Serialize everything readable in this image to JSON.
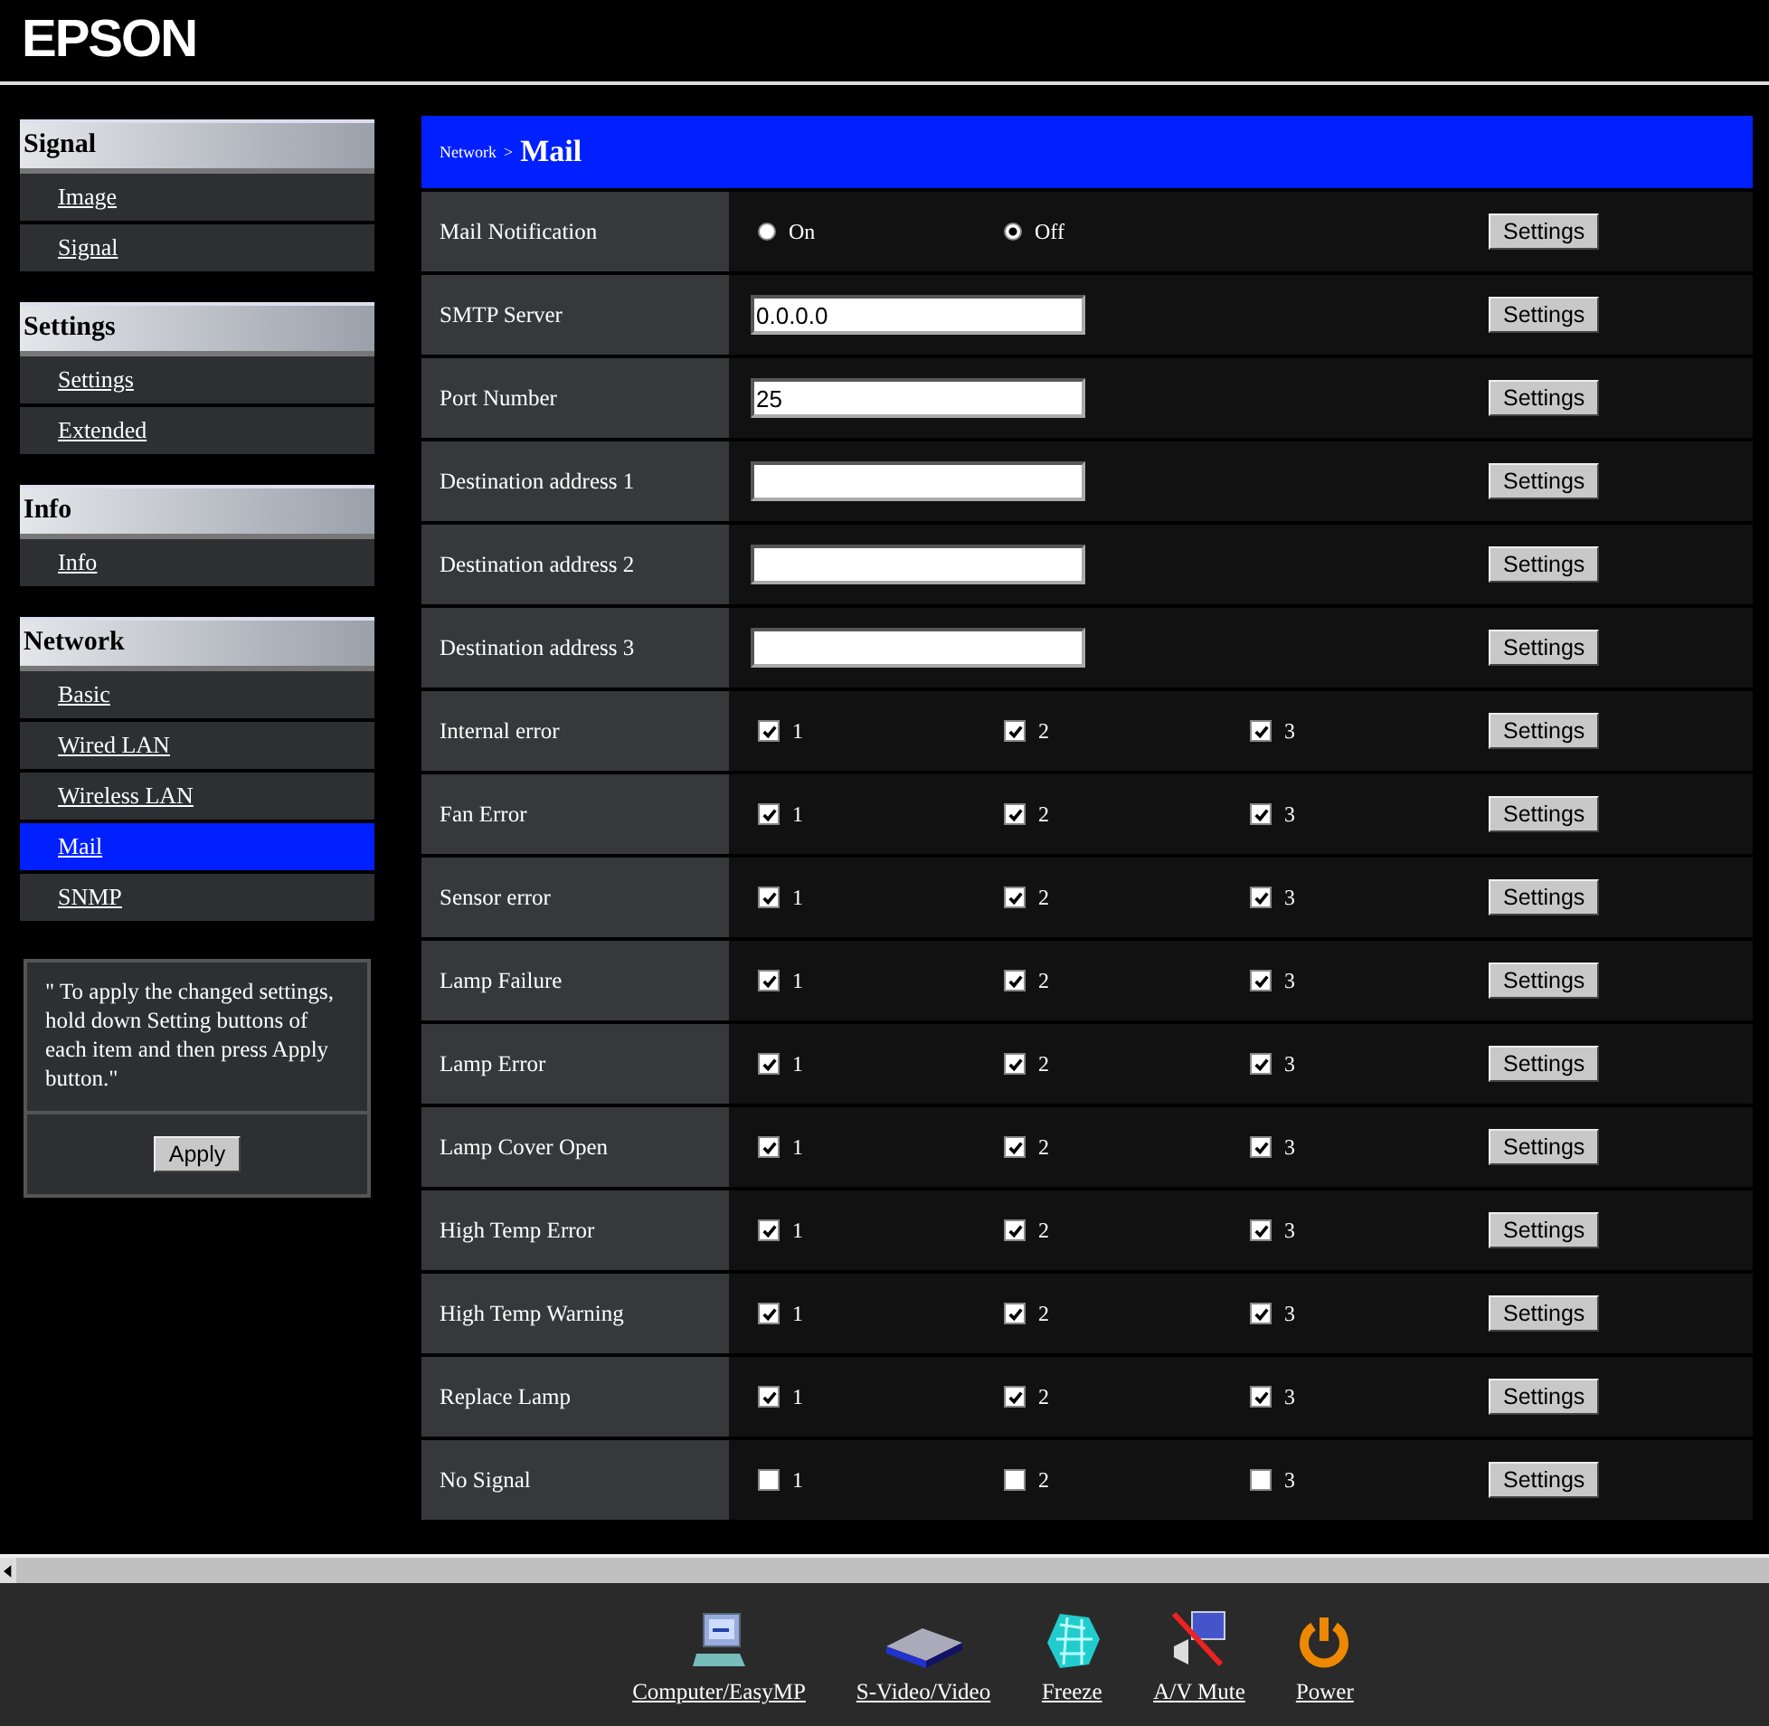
{
  "brand": "EPSON",
  "sidebar": [
    {
      "title": "Signal",
      "items": [
        {
          "label": "Image",
          "selected": false
        },
        {
          "label": "Signal",
          "selected": false
        }
      ]
    },
    {
      "title": "Settings",
      "items": [
        {
          "label": "Settings",
          "selected": false
        },
        {
          "label": "Extended",
          "selected": false
        }
      ]
    },
    {
      "title": "Info",
      "items": [
        {
          "label": "Info",
          "selected": false
        }
      ]
    },
    {
      "title": "Network",
      "items": [
        {
          "label": "Basic",
          "selected": false
        },
        {
          "label": "Wired LAN",
          "selected": false
        },
        {
          "label": "Wireless LAN",
          "selected": false
        },
        {
          "label": "Mail",
          "selected": true
        },
        {
          "label": "SNMP",
          "selected": false
        }
      ]
    }
  ],
  "note": "\" To apply the changed settings, hold down Setting buttons of each item and then press Apply button.\"",
  "apply_button": "Apply",
  "breadcrumb": {
    "parent": "Network",
    "separator": ">",
    "current": "Mail"
  },
  "rows": [
    {
      "kind": "radio",
      "label": "Mail Notification",
      "options": [
        {
          "label": "On",
          "selected": false
        },
        {
          "label": "Off",
          "selected": true
        }
      ],
      "button": "Settings"
    },
    {
      "kind": "text",
      "label": "SMTP Server",
      "value": "0.0.0.0",
      "button": "Settings"
    },
    {
      "kind": "text",
      "label": "Port Number",
      "value": "25",
      "button": "Settings"
    },
    {
      "kind": "text",
      "label": "Destination address 1",
      "button": "Settings"
    },
    {
      "kind": "text",
      "label": "Destination address 2",
      "button": "Settings"
    },
    {
      "kind": "text",
      "label": "Destination address 3",
      "button": "Settings"
    },
    {
      "kind": "checks",
      "label": "Internal error",
      "checks": [
        {
          "label": "1",
          "checked": true
        },
        {
          "label": "2",
          "checked": true
        },
        {
          "label": "3",
          "checked": true
        }
      ],
      "button": "Settings"
    },
    {
      "kind": "checks",
      "label": "Fan Error",
      "checks": [
        {
          "label": "1",
          "checked": true
        },
        {
          "label": "2",
          "checked": true
        },
        {
          "label": "3",
          "checked": true
        }
      ],
      "button": "Settings"
    },
    {
      "kind": "checks",
      "label": "Sensor error",
      "checks": [
        {
          "label": "1",
          "checked": true
        },
        {
          "label": "2",
          "checked": true
        },
        {
          "label": "3",
          "checked": true
        }
      ],
      "button": "Settings"
    },
    {
      "kind": "checks",
      "label": "Lamp Failure",
      "checks": [
        {
          "label": "1",
          "checked": true
        },
        {
          "label": "2",
          "checked": true
        },
        {
          "label": "3",
          "checked": true
        }
      ],
      "button": "Settings"
    },
    {
      "kind": "checks",
      "label": "Lamp Error",
      "checks": [
        {
          "label": "1",
          "checked": true
        },
        {
          "label": "2",
          "checked": true
        },
        {
          "label": "3",
          "checked": true
        }
      ],
      "button": "Settings"
    },
    {
      "kind": "checks",
      "label": "Lamp Cover Open",
      "checks": [
        {
          "label": "1",
          "checked": true
        },
        {
          "label": "2",
          "checked": true
        },
        {
          "label": "3",
          "checked": true
        }
      ],
      "button": "Settings"
    },
    {
      "kind": "checks",
      "label": "High Temp Error",
      "checks": [
        {
          "label": "1",
          "checked": true
        },
        {
          "label": "2",
          "checked": true
        },
        {
          "label": "3",
          "checked": true
        }
      ],
      "button": "Settings"
    },
    {
      "kind": "checks",
      "label": "High Temp Warning",
      "checks": [
        {
          "label": "1",
          "checked": true
        },
        {
          "label": "2",
          "checked": true
        },
        {
          "label": "3",
          "checked": true
        }
      ],
      "button": "Settings"
    },
    {
      "kind": "checks",
      "label": "Replace Lamp",
      "checks": [
        {
          "label": "1",
          "checked": true
        },
        {
          "label": "2",
          "checked": true
        },
        {
          "label": "3",
          "checked": true
        }
      ],
      "button": "Settings"
    },
    {
      "kind": "checks",
      "label": "No Signal",
      "checks": [
        {
          "label": "1",
          "checked": false
        },
        {
          "label": "2",
          "checked": false
        },
        {
          "label": "3",
          "checked": false
        }
      ],
      "button": "Settings"
    }
  ],
  "toolbar": [
    {
      "kind": "computer",
      "label": "Computer/EasyMP"
    },
    {
      "kind": "video",
      "label": "S-Video/Video"
    },
    {
      "kind": "freeze",
      "label": "Freeze"
    },
    {
      "kind": "mute",
      "label": "A/V Mute"
    },
    {
      "kind": "power",
      "label": "Power"
    }
  ]
}
